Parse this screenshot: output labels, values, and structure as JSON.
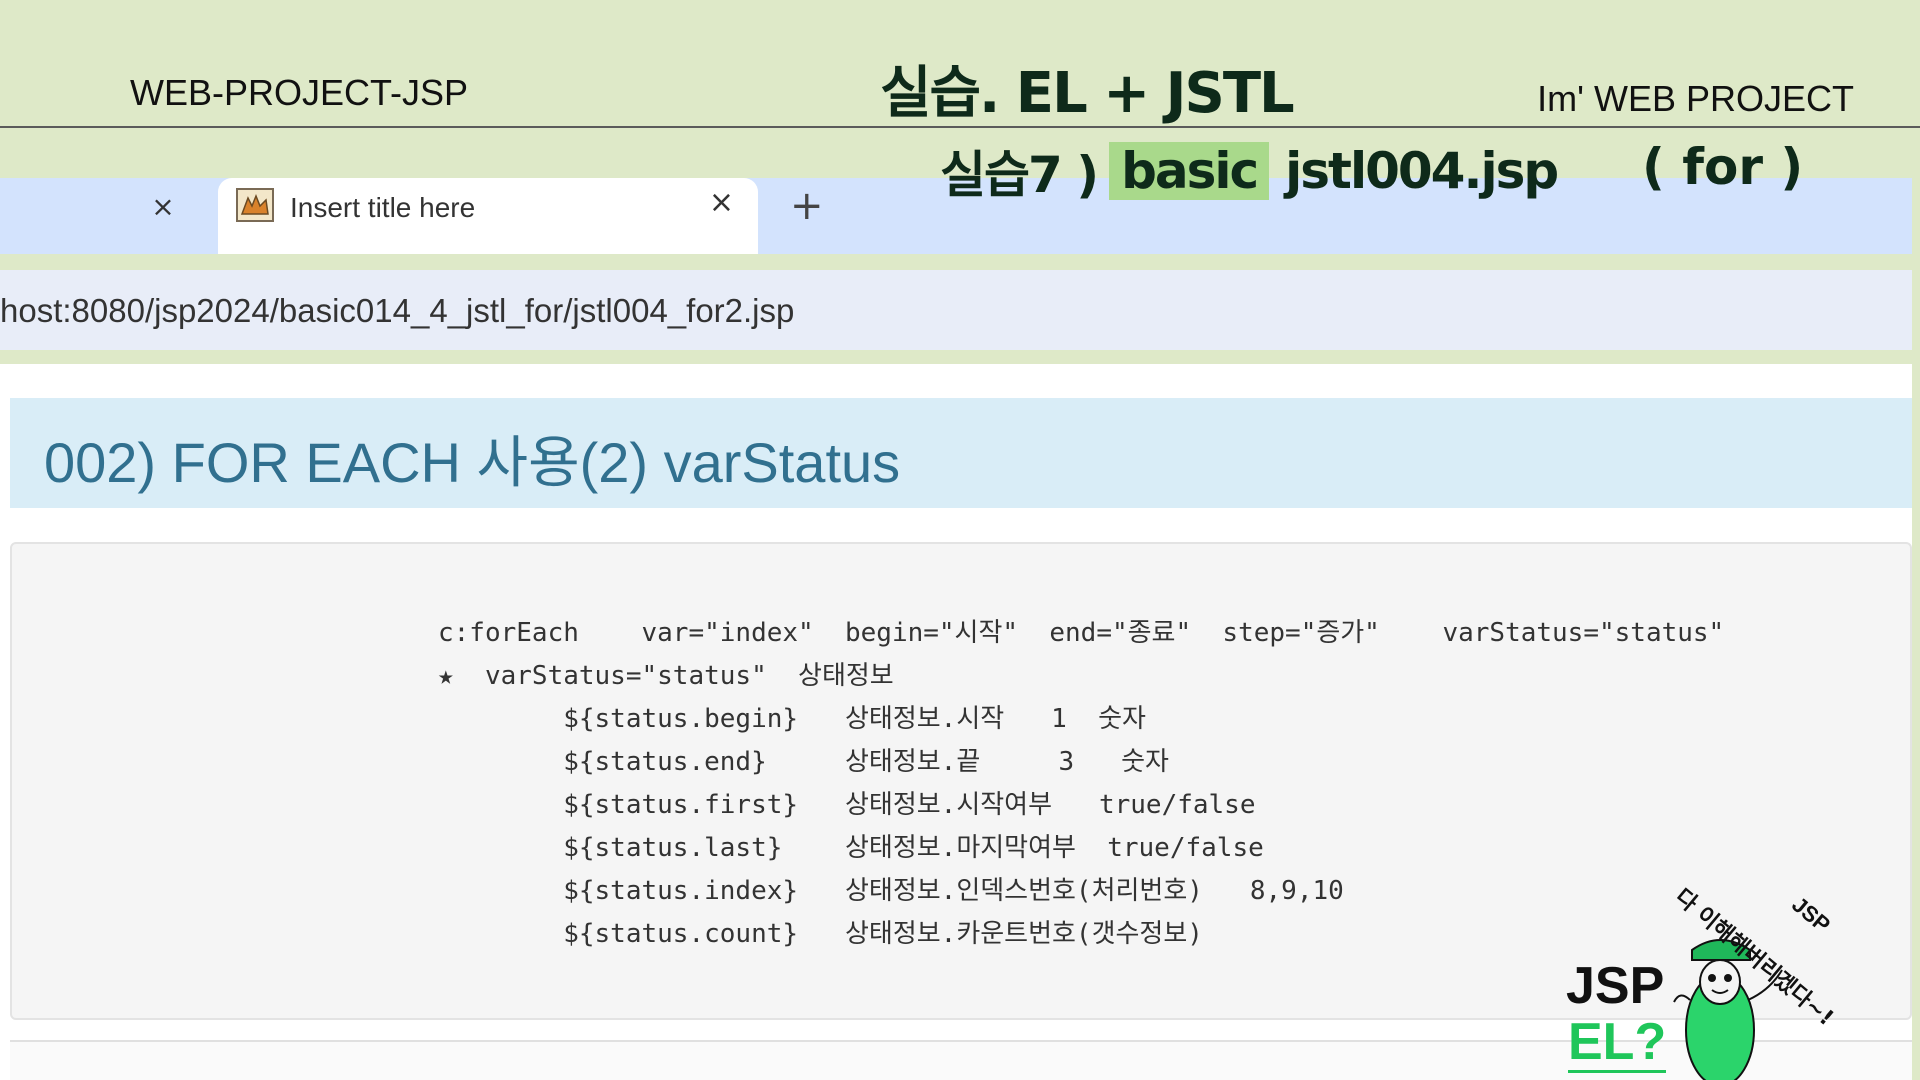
{
  "slide": {
    "project_name": "WEB-PROJECT-JSP",
    "lesson_title": "실습. EL + JSTL",
    "brand": "Im'  WEB PROJECT",
    "subtitle_prefix": "실습7 )",
    "subtitle_highlight": "basic",
    "subtitle_file": "jstl004.jsp",
    "subtitle_topic": "( for )"
  },
  "browser": {
    "prev_tab_close": "×",
    "tab": {
      "title": "Insert title here",
      "close": "×",
      "favicon": "tomcat-icon"
    },
    "new_tab": "+",
    "url": "host:8080/jsp2024/basic014_4_jstl_for/jstl004_for2.jsp"
  },
  "page": {
    "panel_title": "002) FOR EACH 사용(2) varStatus",
    "code_lines": [
      "c:forEach    var=\"index\"  begin=\"시작\"  end=\"종료\"  step=\"증가\"    varStatus=\"status\"",
      "★  varStatus=\"status\"  상태정보",
      "        ${status.begin}   상태정보.시작   1  숫자",
      "        ${status.end}     상태정보.끝     3   숫자",
      "        ${status.first}   상태정보.시작여부   true/false",
      "        ${status.last}    상태정보.마지막여부  true/false",
      "        ${status.index}   상태정보.인덱스번호(처리번호)   8,9,10",
      "        ${status.count}   상태정보.카운트번호(갯수정보)"
    ]
  },
  "mascot": {
    "jsp": "JSP",
    "el": "EL?",
    "bubble": "다 이해해버리겠다~!",
    "bubble_tag": "JSP"
  },
  "colors": {
    "background": "#dee9c8",
    "tab_strip": "#d3e3fd",
    "panel_heading": "#d9edf7",
    "panel_text": "#31708f",
    "highlight": "#a9d98b",
    "mascot_green": "#1fc65a"
  }
}
